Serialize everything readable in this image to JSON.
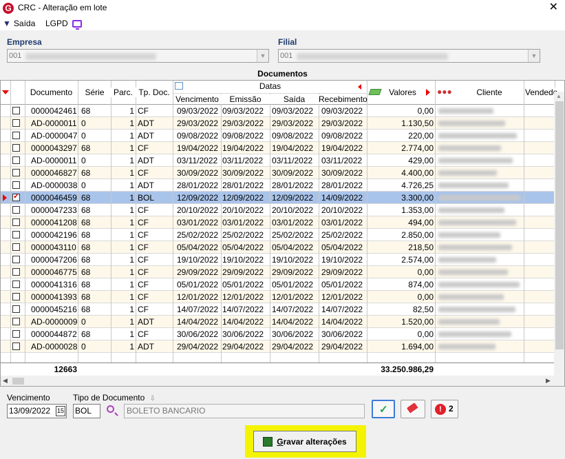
{
  "window": {
    "title": "CRC - Alteração em lote",
    "logo": "G",
    "close": "✕"
  },
  "menu": {
    "exit_label": "Saída",
    "lgpd_label": "LGPD"
  },
  "filters": {
    "empresa_label": "Empresa",
    "empresa_code": "001",
    "filial_label": "Filial",
    "filial_code": "001"
  },
  "grid": {
    "section_title": "Documentos",
    "columns": {
      "documento": "Documento",
      "serie": "Série",
      "parc": "Parc.",
      "tpdoc": "Tp. Doc.",
      "datas": "Datas",
      "vencimento": "Vencimento",
      "emissao": "Emissão",
      "saida": "Saída",
      "recebimento": "Recebimento",
      "valores": "Valores",
      "cliente": "Cliente",
      "vendedor": "Vendedo"
    },
    "rows": [
      {
        "doc": "0000042461",
        "serie": "68",
        "parc": "1",
        "tp": "CF",
        "venc": "09/03/2022",
        "emis": "09/03/2022",
        "saida": "09/03/2022",
        "receb": "09/03/2022",
        "valor": "0,00",
        "checked": false,
        "selected": false
      },
      {
        "doc": "AD-0000011",
        "serie": "0",
        "parc": "1",
        "tp": "ADT",
        "venc": "29/03/2022",
        "emis": "29/03/2022",
        "saida": "29/03/2022",
        "receb": "29/03/2022",
        "valor": "1.130,50",
        "checked": false,
        "selected": false
      },
      {
        "doc": "AD-0000047",
        "serie": "0",
        "parc": "1",
        "tp": "ADT",
        "venc": "09/08/2022",
        "emis": "09/08/2022",
        "saida": "09/08/2022",
        "receb": "09/08/2022",
        "valor": "220,00",
        "checked": false,
        "selected": false
      },
      {
        "doc": "0000043297",
        "serie": "68",
        "parc": "1",
        "tp": "CF",
        "venc": "19/04/2022",
        "emis": "19/04/2022",
        "saida": "19/04/2022",
        "receb": "19/04/2022",
        "valor": "2.774,00",
        "checked": false,
        "selected": false
      },
      {
        "doc": "AD-0000011",
        "serie": "0",
        "parc": "1",
        "tp": "ADT",
        "venc": "03/11/2022",
        "emis": "03/11/2022",
        "saida": "03/11/2022",
        "receb": "03/11/2022",
        "valor": "429,00",
        "checked": false,
        "selected": false
      },
      {
        "doc": "0000046827",
        "serie": "68",
        "parc": "1",
        "tp": "CF",
        "venc": "30/09/2022",
        "emis": "30/09/2022",
        "saida": "30/09/2022",
        "receb": "30/09/2022",
        "valor": "4.400,00",
        "checked": false,
        "selected": false
      },
      {
        "doc": "AD-0000038",
        "serie": "0",
        "parc": "1",
        "tp": "ADT",
        "venc": "28/01/2022",
        "emis": "28/01/2022",
        "saida": "28/01/2022",
        "receb": "28/01/2022",
        "valor": "4.726,25",
        "checked": false,
        "selected": false
      },
      {
        "doc": "0000046459",
        "serie": "68",
        "parc": "1",
        "tp": "BOL",
        "venc": "12/09/2022",
        "emis": "12/09/2022",
        "saida": "12/09/2022",
        "receb": "14/09/2022",
        "valor": "3.300,00",
        "checked": true,
        "selected": true
      },
      {
        "doc": "0000047233",
        "serie": "68",
        "parc": "1",
        "tp": "CF",
        "venc": "20/10/2022",
        "emis": "20/10/2022",
        "saida": "20/10/2022",
        "receb": "20/10/2022",
        "valor": "1.353,00",
        "checked": false,
        "selected": false
      },
      {
        "doc": "0000041208",
        "serie": "68",
        "parc": "1",
        "tp": "CF",
        "venc": "03/01/2022",
        "emis": "03/01/2022",
        "saida": "03/01/2022",
        "receb": "03/01/2022",
        "valor": "494,00",
        "checked": false,
        "selected": false
      },
      {
        "doc": "0000042196",
        "serie": "68",
        "parc": "1",
        "tp": "CF",
        "venc": "25/02/2022",
        "emis": "25/02/2022",
        "saida": "25/02/2022",
        "receb": "25/02/2022",
        "valor": "2.850,00",
        "checked": false,
        "selected": false
      },
      {
        "doc": "0000043110",
        "serie": "68",
        "parc": "1",
        "tp": "CF",
        "venc": "05/04/2022",
        "emis": "05/04/2022",
        "saida": "05/04/2022",
        "receb": "05/04/2022",
        "valor": "218,50",
        "checked": false,
        "selected": false
      },
      {
        "doc": "0000047206",
        "serie": "68",
        "parc": "1",
        "tp": "CF",
        "venc": "19/10/2022",
        "emis": "19/10/2022",
        "saida": "19/10/2022",
        "receb": "19/10/2022",
        "valor": "2.574,00",
        "checked": false,
        "selected": false
      },
      {
        "doc": "0000046775",
        "serie": "68",
        "parc": "1",
        "tp": "CF",
        "venc": "29/09/2022",
        "emis": "29/09/2022",
        "saida": "29/09/2022",
        "receb": "29/09/2022",
        "valor": "0,00",
        "checked": false,
        "selected": false
      },
      {
        "doc": "0000041316",
        "serie": "68",
        "parc": "1",
        "tp": "CF",
        "venc": "05/01/2022",
        "emis": "05/01/2022",
        "saida": "05/01/2022",
        "receb": "05/01/2022",
        "valor": "874,00",
        "checked": false,
        "selected": false
      },
      {
        "doc": "0000041393",
        "serie": "68",
        "parc": "1",
        "tp": "CF",
        "venc": "12/01/2022",
        "emis": "12/01/2022",
        "saida": "12/01/2022",
        "receb": "12/01/2022",
        "valor": "0,00",
        "checked": false,
        "selected": false
      },
      {
        "doc": "0000045216",
        "serie": "68",
        "parc": "1",
        "tp": "CF",
        "venc": "14/07/2022",
        "emis": "14/07/2022",
        "saida": "14/07/2022",
        "receb": "14/07/2022",
        "valor": "82,50",
        "checked": false,
        "selected": false
      },
      {
        "doc": "AD-0000009",
        "serie": "0",
        "parc": "1",
        "tp": "ADT",
        "venc": "14/04/2022",
        "emis": "14/04/2022",
        "saida": "14/04/2022",
        "receb": "14/04/2022",
        "valor": "1.520,00",
        "checked": false,
        "selected": false
      },
      {
        "doc": "0000044872",
        "serie": "68",
        "parc": "1",
        "tp": "CF",
        "venc": "30/06/2022",
        "emis": "30/06/2022",
        "saida": "30/06/2022",
        "receb": "30/06/2022",
        "valor": "0,00",
        "checked": false,
        "selected": false
      },
      {
        "doc": "AD-0000028",
        "serie": "0",
        "parc": "1",
        "tp": "ADT",
        "venc": "29/04/2022",
        "emis": "29/04/2022",
        "saida": "29/04/2022",
        "receb": "29/04/2022",
        "valor": "1.694,00",
        "checked": false,
        "selected": false
      }
    ],
    "footer_count": "12663",
    "footer_total": "33.250.986,29"
  },
  "bottom": {
    "vencimento_label": "Vencimento",
    "vencimento_value": "13/09/2022",
    "calendar_glyph": "15",
    "tipo_label": "Tipo de Documento",
    "tipo_value": "BOL",
    "tipo_desc": "BOLETO BANCARIO",
    "alert_count": "2",
    "save_label": "Gravar alterações"
  },
  "colors": {
    "selected_row": "#a9c4ea",
    "alt_row": "#fdf8ea",
    "save_highlight": "#f4f400"
  }
}
